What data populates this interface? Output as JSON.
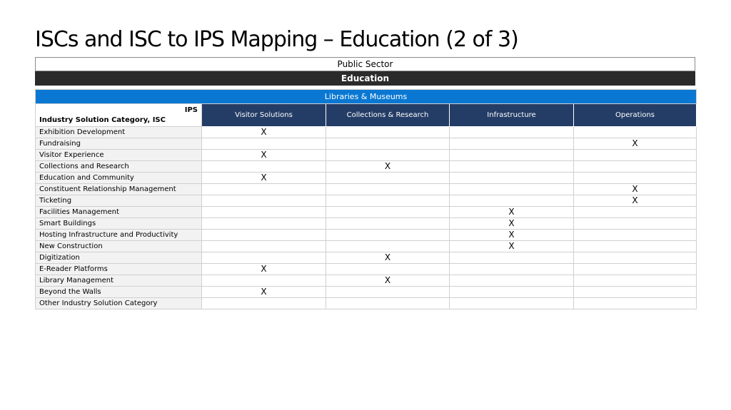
{
  "title": "ISCs and ISC to IPS Mapping – Education (2 of 3)",
  "sector": "Public Sector",
  "industry": "Education",
  "subindustry": "Libraries & Museums",
  "corner": {
    "ips": "IPS",
    "isc": "Industry Solution Category, ISC"
  },
  "columns": [
    "Visitor Solutions",
    "Collections & Research",
    "Infrastructure",
    "Operations"
  ],
  "rows": [
    {
      "name": "Exhibition Development",
      "cells": [
        "X",
        "",
        "",
        ""
      ]
    },
    {
      "name": "Fundraising",
      "cells": [
        "",
        "",
        "",
        "X"
      ]
    },
    {
      "name": "Visitor Experience",
      "cells": [
        "X",
        "",
        "",
        ""
      ]
    },
    {
      "name": "Collections and Research",
      "cells": [
        "",
        "X",
        "",
        ""
      ]
    },
    {
      "name": "Education and Community",
      "cells": [
        "X",
        "",
        "",
        ""
      ]
    },
    {
      "name": "Constituent Relationship Management",
      "cells": [
        "",
        "",
        "",
        "X"
      ]
    },
    {
      "name": "Ticketing",
      "cells": [
        "",
        "",
        "",
        "X"
      ]
    },
    {
      "name": "Facilities Management",
      "cells": [
        "",
        "",
        "X",
        ""
      ]
    },
    {
      "name": "Smart Buildings",
      "cells": [
        "",
        "",
        "X",
        ""
      ]
    },
    {
      "name": "Hosting Infrastructure and Productivity",
      "cells": [
        "",
        "",
        "X",
        ""
      ]
    },
    {
      "name": "New Construction",
      "cells": [
        "",
        "",
        "X",
        ""
      ]
    },
    {
      "name": "Digitization",
      "cells": [
        "",
        "X",
        "",
        ""
      ]
    },
    {
      "name": "E-Reader Platforms",
      "cells": [
        "X",
        "",
        "",
        ""
      ]
    },
    {
      "name": "Library Management",
      "cells": [
        "",
        "X",
        "",
        ""
      ]
    },
    {
      "name": "Beyond the Walls",
      "cells": [
        "X",
        "",
        "",
        ""
      ]
    },
    {
      "name": "Other Industry Solution Category",
      "cells": [
        "",
        "",
        "",
        ""
      ]
    }
  ]
}
